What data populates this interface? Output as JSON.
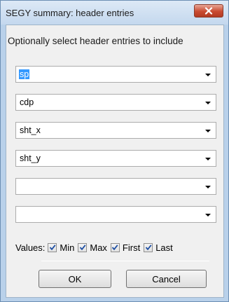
{
  "window": {
    "title": "SEGY summary: header entries",
    "close_icon": "close-icon"
  },
  "dialog": {
    "instruction": "Optionally select header entries to include",
    "combos": [
      {
        "value": "sp",
        "selected_text": true
      },
      {
        "value": "cdp"
      },
      {
        "value": "sht_x"
      },
      {
        "value": "sht_y"
      },
      {
        "value": ""
      },
      {
        "value": ""
      }
    ],
    "values_label": "Values:",
    "checkboxes": [
      {
        "label": "Min",
        "checked": true
      },
      {
        "label": "Max",
        "checked": true
      },
      {
        "label": "First",
        "checked": true
      },
      {
        "label": "Last",
        "checked": true
      }
    ],
    "ok_label": "OK",
    "cancel_label": "Cancel"
  },
  "colors": {
    "selection": "#3399ff",
    "close_button": "#c94b31",
    "checkmark": "#1f4fa3"
  }
}
